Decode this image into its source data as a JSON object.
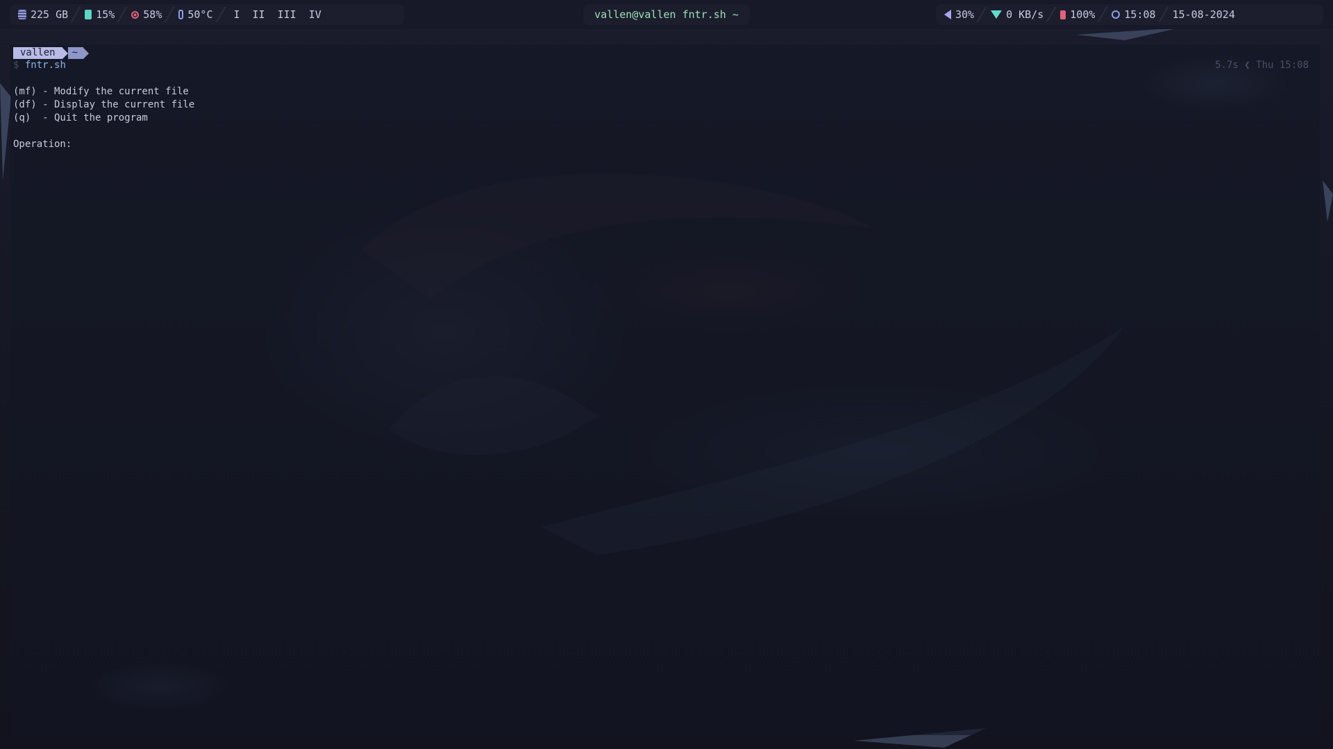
{
  "topbar": {
    "disk": {
      "icon": "disk-icon",
      "value": "225 GB"
    },
    "memory": {
      "icon": "memory-icon",
      "value": "15%"
    },
    "cpu": {
      "icon": "cpu-icon",
      "value": "58%"
    },
    "temperature": {
      "icon": "thermometer-icon",
      "value": "50°C"
    },
    "workspaces": [
      "I",
      "II",
      "III",
      "IV"
    ],
    "window_title": "vallen@vallen fntr.sh ~",
    "volume": {
      "icon": "speaker-icon",
      "value": "30%"
    },
    "network": {
      "icon": "wifi-icon",
      "value": "0 KB/s"
    },
    "battery": {
      "icon": "battery-icon",
      "value": "100%"
    },
    "clock": {
      "icon": "clock-icon",
      "value": "15:08"
    },
    "date": "15-08-2024"
  },
  "terminal": {
    "prompt": {
      "user": "vallen",
      "dir": "~",
      "symbol": "$",
      "command": "fntr.sh"
    },
    "right_prompt": {
      "duration": "5.7s",
      "separator": "❮",
      "datetime": "Thu 15:08"
    },
    "menu": [
      "(mf) - Modify the current file",
      "(df) - Display the current file",
      "(q)  - Quit the program"
    ],
    "input_label": "Operation:"
  },
  "colors": {
    "background": "#151724",
    "bar": "#1c1e2e",
    "title_green": "#9ee0b4",
    "accent_red": "#e0637b",
    "accent_teal": "#64d9cf",
    "accent_purple": "#a9a4f0"
  }
}
